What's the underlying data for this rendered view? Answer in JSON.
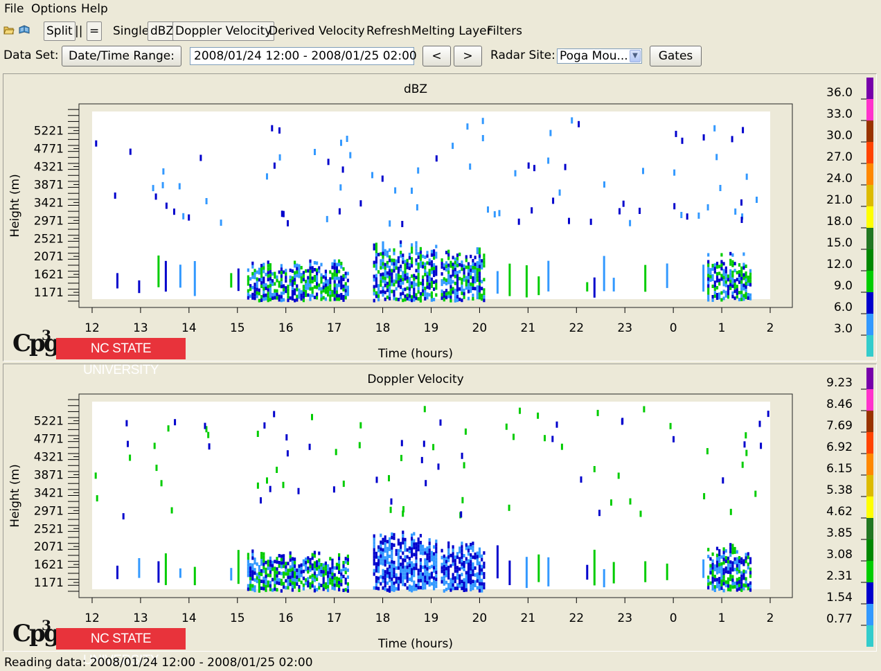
{
  "menu": [
    "File",
    "Options",
    "Help"
  ],
  "toolbar": {
    "icons": [
      "open-folder-icon",
      "open-book-icon"
    ],
    "split_label": "Split",
    "vertical_layout_label": "||",
    "horizontal_layout_label": "=",
    "single_label": "Single",
    "dbz_label": "dBZ",
    "doppler_label": "Doppler Velocity",
    "derived_label": "Derived Velocity",
    "refresh_label": "Refresh",
    "melting_label": "Melting Layer",
    "filters_label": "Filters"
  },
  "dataset": {
    "label": "Data Set:",
    "range_button": "Date/Time Range:",
    "range_value": "2008/01/24 12:00 - 2008/01/25 02:00",
    "prev_label": "<",
    "next_label": ">",
    "site_label": "Radar Site:",
    "site_value": "Poga Mou...",
    "gates_label": "Gates"
  },
  "logo": {
    "cpg": "Cpg",
    "cpg_superscript": "3",
    "university": "NC STATE UNIVERSITY",
    "university_color": "#e8333b"
  },
  "status": "Reading data: 2008/01/24 12:00 - 2008/01/25 02:00",
  "chart_data": [
    {
      "type": "heatmap",
      "title": "dBZ",
      "xlabel": "Time (hours)",
      "ylabel": "Height (m)",
      "x_tick_labels": [
        "12",
        "13",
        "14",
        "15",
        "16",
        "17",
        "18",
        "19",
        "20",
        "21",
        "22",
        "23",
        "0",
        "1",
        "2"
      ],
      "y_tick_labels": [
        "1171",
        "1621",
        "2071",
        "2521",
        "2971",
        "3421",
        "3871",
        "4321",
        "4771",
        "5221"
      ],
      "y_tick_values": [
        1171,
        1621,
        2071,
        2521,
        2971,
        3421,
        3871,
        4321,
        4771,
        5221
      ],
      "x_range": [
        12,
        26
      ],
      "y_range": [
        1000,
        5700
      ],
      "colorbar": {
        "labels": [
          "3.0",
          "6.0",
          "9.0",
          "12.0",
          "15.0",
          "18.0",
          "21.0",
          "24.0",
          "27.0",
          "30.0",
          "33.0",
          "36.0"
        ],
        "colors": [
          "#33cccc",
          "#3399ff",
          "#0000cc",
          "#00cc00",
          "#008800",
          "#227722",
          "#ffff00",
          "#ddbb00",
          "#ff8800",
          "#ff4400",
          "#993300",
          "#ff33cc",
          "#7700aa"
        ]
      },
      "regions": [
        {
          "description": "dense low-level echoes",
          "x": [
            15.2,
            17.3
          ],
          "y": [
            1000,
            2000
          ],
          "dominant": [
            "#0000cc",
            "#3399ff",
            "#00cc00"
          ]
        },
        {
          "description": "dense low-level echoes",
          "x": [
            17.8,
            19.1
          ],
          "y": [
            1000,
            2500
          ],
          "dominant": [
            "#0000cc",
            "#3399ff",
            "#00cc00"
          ]
        },
        {
          "description": "dense low-level echoes",
          "x": [
            19.2,
            20.1
          ],
          "y": [
            1000,
            2300
          ],
          "dominant": [
            "#0000cc",
            "#3399ff",
            "#00cc00"
          ]
        },
        {
          "description": "dense low-level echoes",
          "x": [
            24.7,
            25.6
          ],
          "y": [
            1000,
            2200
          ],
          "dominant": [
            "#0000cc",
            "#3399ff",
            "#00cc00"
          ]
        },
        {
          "description": "scattered upper returns",
          "x": [
            12,
            26
          ],
          "y": [
            2900,
            5600
          ],
          "dominant": [
            "#3399ff",
            "#0000cc"
          ]
        }
      ]
    },
    {
      "type": "heatmap",
      "title": "Doppler Velocity",
      "xlabel": "Time (hours)",
      "ylabel": "Height (m)",
      "x_tick_labels": [
        "12",
        "13",
        "14",
        "15",
        "16",
        "17",
        "18",
        "19",
        "20",
        "21",
        "22",
        "23",
        "0",
        "1",
        "2"
      ],
      "y_tick_labels": [
        "1171",
        "1621",
        "2071",
        "2521",
        "2971",
        "3421",
        "3871",
        "4321",
        "4771",
        "5221"
      ],
      "y_tick_values": [
        1171,
        1621,
        2071,
        2521,
        2971,
        3421,
        3871,
        4321,
        4771,
        5221
      ],
      "x_range": [
        12,
        26
      ],
      "y_range": [
        1000,
        5700
      ],
      "colorbar": {
        "labels": [
          "0.77",
          "1.54",
          "2.31",
          "3.08",
          "3.85",
          "4.62",
          "5.38",
          "6.15",
          "6.92",
          "7.69",
          "8.46",
          "9.23"
        ],
        "colors": [
          "#33cccc",
          "#3399ff",
          "#0000cc",
          "#00cc00",
          "#008800",
          "#227722",
          "#ffff00",
          "#ddbb00",
          "#ff8800",
          "#ff4400",
          "#993300",
          "#ff33cc",
          "#7700aa"
        ]
      },
      "regions": [
        {
          "description": "dense low-level echoes",
          "x": [
            15.2,
            17.3
          ],
          "y": [
            1000,
            2000
          ],
          "dominant": [
            "#0000cc",
            "#3399ff",
            "#00cc00"
          ]
        },
        {
          "description": "dense low-level echoes",
          "x": [
            17.8,
            19.1
          ],
          "y": [
            1000,
            2500
          ],
          "dominant": [
            "#3399ff",
            "#0000cc"
          ]
        },
        {
          "description": "dense low-level echoes",
          "x": [
            19.2,
            20.1
          ],
          "y": [
            1000,
            2300
          ],
          "dominant": [
            "#3399ff",
            "#0000cc"
          ]
        },
        {
          "description": "dense low-level echoes",
          "x": [
            24.7,
            25.6
          ],
          "y": [
            1000,
            2200
          ],
          "dominant": [
            "#0000cc",
            "#3399ff",
            "#00cc00"
          ]
        },
        {
          "description": "scattered upper returns",
          "x": [
            12,
            26
          ],
          "y": [
            2900,
            5600
          ],
          "dominant": [
            "#00cc00",
            "#0000cc"
          ]
        }
      ]
    }
  ]
}
